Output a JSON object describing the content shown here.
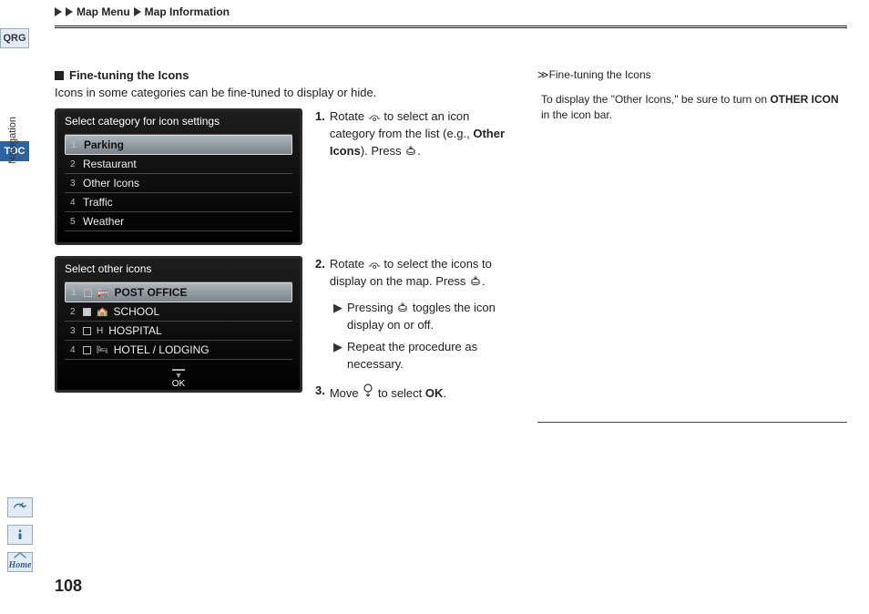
{
  "header": {
    "crumb1": "Map Menu",
    "crumb2": "Map Information"
  },
  "tabs": {
    "qrg": "QRG",
    "toc": "TOC",
    "nav": "Navigation",
    "home": "Home"
  },
  "section": {
    "title": "Fine-tuning the Icons",
    "intro": "Icons in some categories can be fine-tuned to display or hide."
  },
  "screen1": {
    "title": "Select category for icon settings",
    "items": [
      "Parking",
      "Restaurant",
      "Other Icons",
      "Traffic",
      "Weather"
    ]
  },
  "screen2": {
    "title": "Select other icons",
    "items": [
      {
        "label": "POST OFFICE",
        "checked": false,
        "icon": "🏣"
      },
      {
        "label": "SCHOOL",
        "checked": true,
        "icon": "🏫"
      },
      {
        "label": "HOSPITAL",
        "checked": false,
        "icon": "H"
      },
      {
        "label": "HOTEL / LODGING",
        "checked": false,
        "icon": "🛏"
      }
    ],
    "ok": "OK"
  },
  "steps": {
    "s1a": "Rotate ",
    "s1b": " to select an icon category from the list (e.g., ",
    "s1bold": "Other Icons",
    "s1c": "). Press ",
    "s1d": ".",
    "s2a": "Rotate ",
    "s2b": " to select the icons to display on the map. Press ",
    "s2c": ".",
    "s2sub1a": "Pressing ",
    "s2sub1b": " toggles the icon display on or off.",
    "s2sub2": "Repeat the procedure as necessary.",
    "s3a": "Move ",
    "s3b": " to select ",
    "s3bold": "OK",
    "s3c": "."
  },
  "side": {
    "crumb": "Fine-tuning the Icons",
    "t1": "To display the \"Other Icons,\" be sure to turn on ",
    "t1bold": "OTHER ICON",
    "t1b": " in the icon bar."
  },
  "pagenum": "108"
}
